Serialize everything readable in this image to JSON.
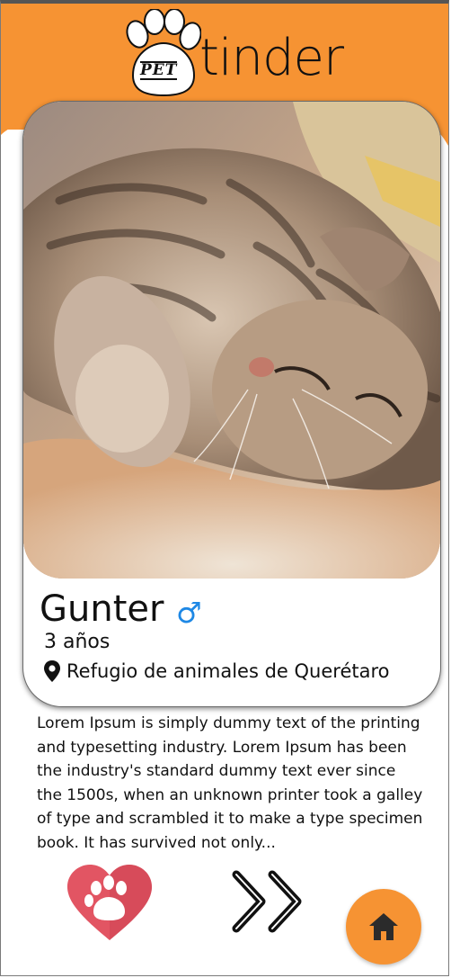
{
  "header": {
    "logo_small": "PET",
    "logo_text": "tinder",
    "background_color": "#f69333"
  },
  "pet": {
    "name": "Gunter",
    "gender_symbol": "♂",
    "age": "3 años",
    "location": "Refugio de animales de Querétaro",
    "description": "Lorem Ipsum is simply dummy text of the printing and typesetting industry. Lorem Ipsum has been the industry's standard dummy text ever since the 1500s, when an unknown printer took a galley of type and scrambled it to make a type specimen book. It has survived not only..."
  },
  "icons": {
    "gender": "male-icon",
    "location": "map-pin-icon",
    "like": "heart-paw-icon",
    "next": "double-chevron-right-icon",
    "home": "home-icon"
  },
  "colors": {
    "accent": "#f69333",
    "like": "#e25563",
    "gender": "#1e88e5"
  }
}
